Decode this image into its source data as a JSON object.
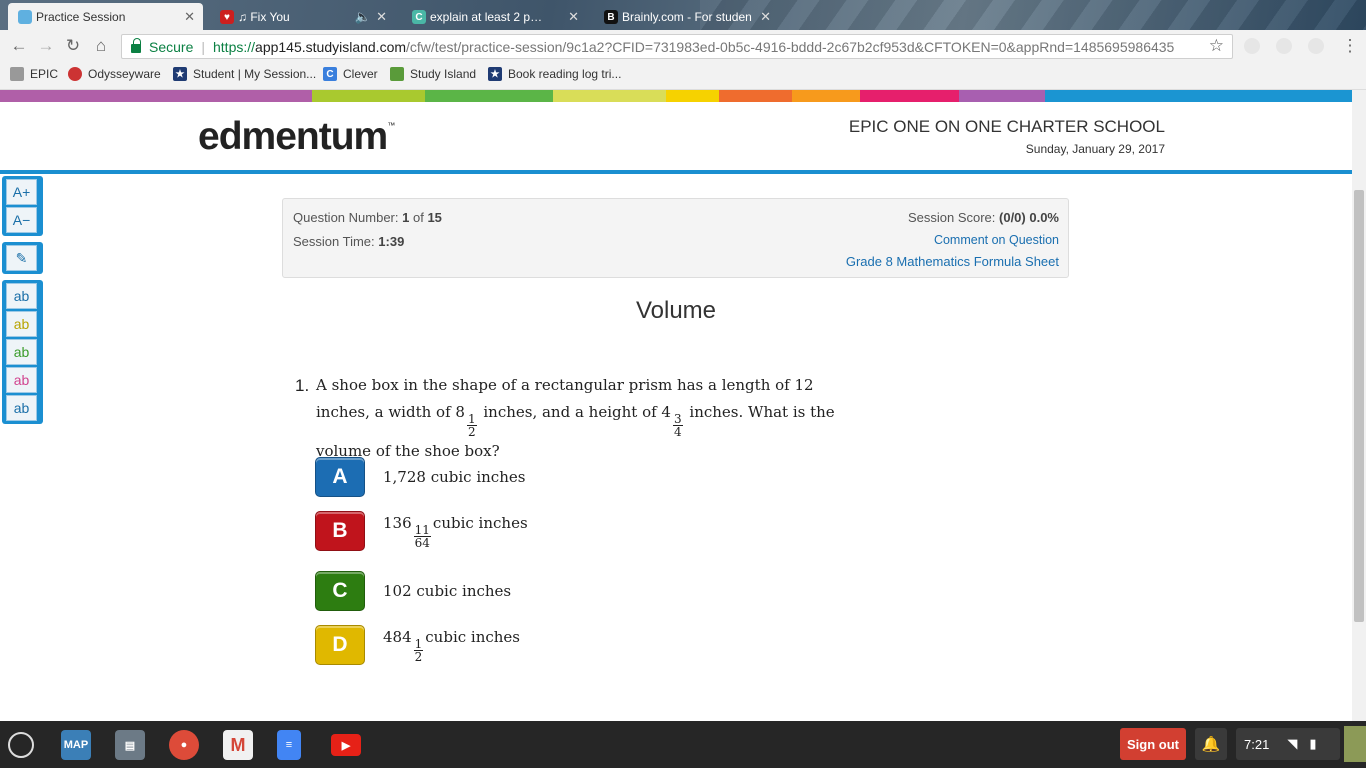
{
  "browser": {
    "tabs": [
      {
        "title": "Practice Session",
        "favicon_color": "#5fb0e0",
        "active": true
      },
      {
        "title": "♫ Fix You",
        "favicon_color": "#cc1f1f",
        "active": false
      },
      {
        "title": "explain at least 2 p…",
        "favicon_color": "#4ab7a6",
        "active": false
      },
      {
        "title": "Brainly.com - For studen",
        "favicon_color": "#111111",
        "active": false
      }
    ],
    "secure_label": "Secure",
    "url_scheme": "https://",
    "url_host": "app145.studyisland.com",
    "url_path": "/cfw/test/practice-session/9c1a2?CFID=731983ed-0b5c-4916-bddd-2c67b2cf953d&CFTOKEN=0&appRnd=1485695986435",
    "bookmarks": [
      {
        "label": "EPIC",
        "icon": "folder-icon"
      },
      {
        "label": "Odysseyware",
        "icon": "odysseyware-icon"
      },
      {
        "label": "Student | My Session...",
        "icon": "star-icon"
      },
      {
        "label": "Clever",
        "icon": "clever-icon"
      },
      {
        "label": "Study Island",
        "icon": "palm-icon"
      },
      {
        "label": "Book reading log tri...",
        "icon": "star-icon"
      }
    ]
  },
  "header": {
    "logo": "edmentum",
    "logo_tm": "™",
    "school": "EPIC ONE ON ONE CHARTER SCHOOL",
    "date": "Sunday, January 29, 2017"
  },
  "info": {
    "question_label": "Question Number:",
    "question_current": "1",
    "question_of": "of",
    "question_total": "15",
    "time_label": "Session Time:",
    "time_value": "1:39",
    "score_label": "Session Score:",
    "score_value": "(0/0) 0.0%",
    "comment_link": "Comment on Question",
    "formula_link": "Grade 8 Mathematics Formula Sheet"
  },
  "topic": "Volume",
  "question": {
    "number": "1.",
    "text_part1": "A shoe box in the shape of a rectangular prism has a length of 12 inches, a width of 8",
    "width_frac_num": "1",
    "width_frac_den": "2",
    "text_part2": "inches, and a height of 4",
    "height_frac_num": "3",
    "height_frac_den": "4",
    "text_part3": "inches. What is the volume of the shoe box?"
  },
  "answers": [
    {
      "letter": "A",
      "whole": "1,728 cubic inches",
      "color": "#1c6db3"
    },
    {
      "letter": "B",
      "whole": "136",
      "num": "11",
      "den": "64",
      "unit": "cubic inches",
      "color": "#c0141c"
    },
    {
      "letter": "C",
      "whole": "102 cubic inches",
      "color": "#2d7d11"
    },
    {
      "letter": "D",
      "whole": "484",
      "num": "1",
      "den": "2",
      "unit": "cubic inches",
      "color": "#e0b800"
    }
  ],
  "shelf": {
    "apps": [
      {
        "name": "MAP",
        "color": "#3b7fb7"
      },
      {
        "name": "files-app",
        "color": "#6c7a86"
      },
      {
        "name": "chrome-app",
        "color": "#dd4b39"
      },
      {
        "name": "gmail-app",
        "color": "#d44638"
      },
      {
        "name": "docs-app",
        "color": "#4285f4"
      },
      {
        "name": "youtube-app",
        "color": "#e62117"
      }
    ],
    "signout": "Sign out",
    "time": "7:21"
  }
}
